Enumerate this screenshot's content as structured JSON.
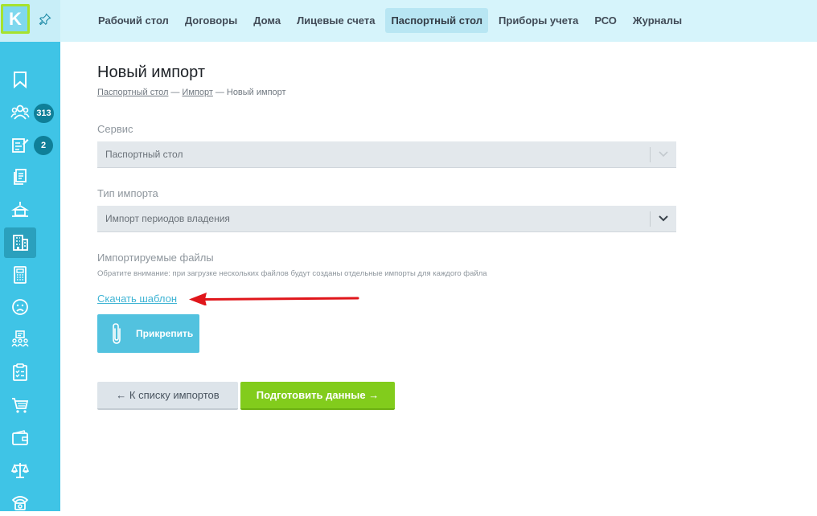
{
  "logo": {
    "letter": "K"
  },
  "sidebar": {
    "badges": {
      "residents": "313",
      "tasks": "2"
    }
  },
  "topnav": {
    "items": [
      {
        "label": "Рабочий стол"
      },
      {
        "label": "Договоры"
      },
      {
        "label": "Дома"
      },
      {
        "label": "Лицевые счета"
      },
      {
        "label": "Паспортный стол"
      },
      {
        "label": "Приборы учета"
      },
      {
        "label": "РСО"
      },
      {
        "label": "Журналы"
      }
    ],
    "active": "Паспортный стол"
  },
  "page": {
    "title": "Новый импорт",
    "breadcrumb": {
      "link1": "Паспортный стол",
      "link2": "Импорт",
      "current": "Новый импорт",
      "separator": "—"
    }
  },
  "form": {
    "service": {
      "label": "Сервис",
      "value": "Паспортный стол"
    },
    "import_type": {
      "label": "Тип импорта",
      "value": "Импорт периодов владения"
    },
    "files": {
      "label": "Импортируемые файлы",
      "note": "Обратите внимание: при загрузке нескольких файлов будут созданы отдельные импорты для каждого файла",
      "download_link": "Скачать шаблон",
      "attach_label": "Прикрепить"
    }
  },
  "actions": {
    "back_label": "← К списку импортов",
    "next_label": "Подготовить данные →"
  },
  "colors": {
    "sidebar": "#3fc4e6",
    "topbar": "#d6f4fb",
    "accent_green": "#82cc1c",
    "annotation_arrow": "#e0161b"
  }
}
